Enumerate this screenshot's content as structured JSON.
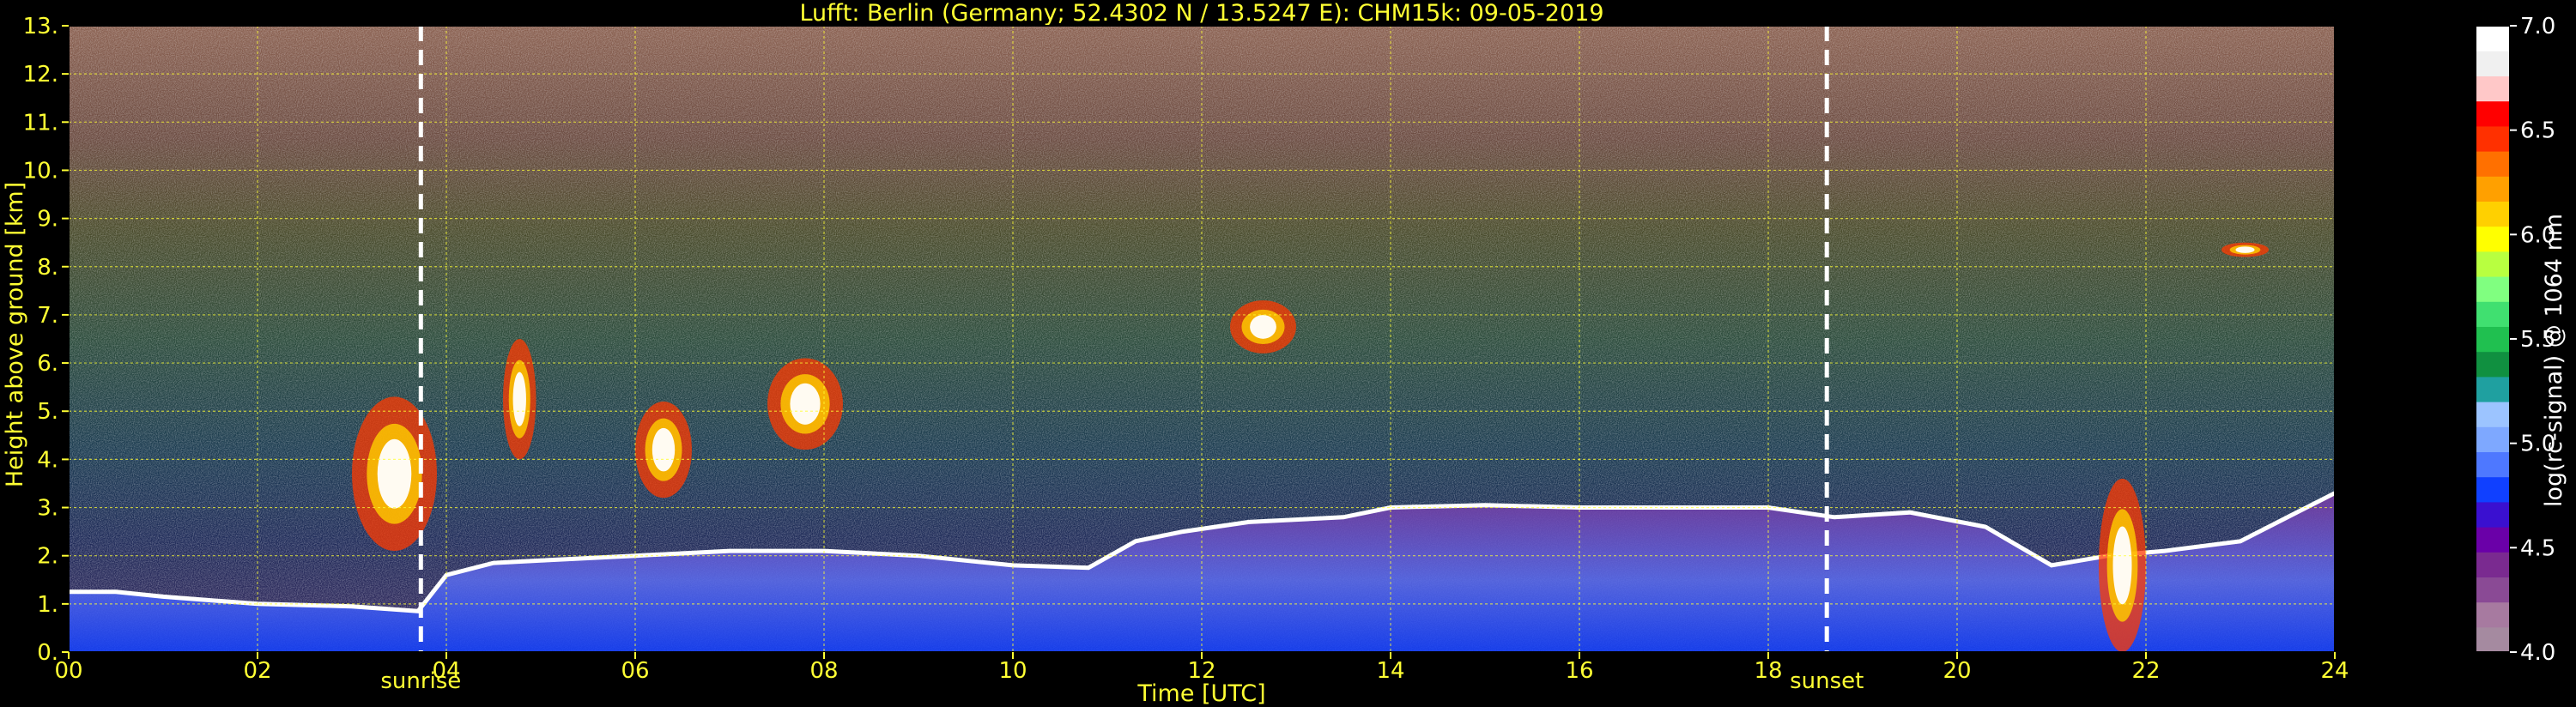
{
  "chart_data": {
    "type": "heatmap",
    "title": "Lufft: Berlin (Germany; 52.4302 N / 13.5247 E):    CHM15k: 09-05-2019",
    "xlabel": "Time [UTC]",
    "ylabel": "Height above ground [km]",
    "xlim": [
      0,
      24
    ],
    "ylim": [
      0,
      13
    ],
    "x_ticks": [
      "00",
      "02",
      "04",
      "06",
      "08",
      "10",
      "12",
      "14",
      "16",
      "18",
      "20",
      "22",
      "24"
    ],
    "y_ticks": [
      "0.",
      "1.",
      "2.",
      "3.",
      "4.",
      "5.",
      "6.",
      "7.",
      "8.",
      "9.",
      "10.",
      "11.",
      "12.",
      "13."
    ],
    "grid": true,
    "colorbar": {
      "label": "log(rc-signal) @ 1064 nm",
      "range": [
        4.0,
        7.0
      ],
      "ticks": [
        "4.0",
        "4.5",
        "5.0",
        "5.5",
        "6.0",
        "6.5",
        "7.0"
      ],
      "colors": [
        "#a58aa0",
        "#a77aa0",
        "#8a4a95",
        "#7a2a90",
        "#6a00a8",
        "#3a10d0",
        "#1040ff",
        "#4e78ff",
        "#7ea8ff",
        "#9cc4ff",
        "#1fa0a0",
        "#109040",
        "#20c050",
        "#40e070",
        "#80ff80",
        "#b8ff40",
        "#ffff00",
        "#ffd000",
        "#ffa000",
        "#ff7000",
        "#ff3000",
        "#ff0000",
        "#ffc8c8",
        "#f0f0f0",
        "#ffffff"
      ]
    },
    "markers": [
      {
        "label": "sunrise",
        "x": 3.73
      },
      {
        "label": "sunset",
        "x": 18.62
      }
    ],
    "boundary_layer_top_km": {
      "x": [
        0.0,
        0.5,
        1.0,
        2.0,
        3.0,
        3.7,
        4.0,
        4.5,
        5.0,
        6.0,
        7.0,
        8.0,
        9.0,
        10.0,
        10.8,
        11.3,
        11.8,
        12.5,
        13.5,
        14.0,
        15.0,
        16.0,
        17.0,
        18.0,
        18.7,
        19.5,
        20.3,
        21.0,
        21.6,
        22.2,
        23.0,
        24.0
      ],
      "y": [
        1.25,
        1.25,
        1.15,
        1.0,
        0.95,
        0.85,
        1.6,
        1.85,
        1.9,
        2.0,
        2.1,
        2.1,
        2.0,
        1.8,
        1.75,
        2.3,
        2.5,
        2.7,
        2.8,
        3.0,
        3.05,
        3.0,
        3.0,
        3.0,
        2.8,
        2.9,
        2.6,
        1.8,
        2.0,
        2.1,
        2.3,
        3.3
      ]
    },
    "cloud_features": [
      {
        "x_range": [
          3.0,
          3.9
        ],
        "y_range_km": [
          2.1,
          5.3
        ]
      },
      {
        "x_range": [
          4.6,
          4.95
        ],
        "y_range_km": [
          4.0,
          6.5
        ]
      },
      {
        "x_range": [
          6.0,
          6.6
        ],
        "y_range_km": [
          3.2,
          5.2
        ]
      },
      {
        "x_range": [
          7.4,
          8.2
        ],
        "y_range_km": [
          4.2,
          6.1
        ]
      },
      {
        "x_range": [
          12.3,
          13.0
        ],
        "y_range_km": [
          6.2,
          7.3
        ]
      },
      {
        "x_range": [
          21.5,
          22.0
        ],
        "y_range_km": [
          0.0,
          3.6
        ]
      },
      {
        "x_range": [
          22.8,
          23.3
        ],
        "y_range_km": [
          8.2,
          8.5
        ]
      }
    ]
  }
}
